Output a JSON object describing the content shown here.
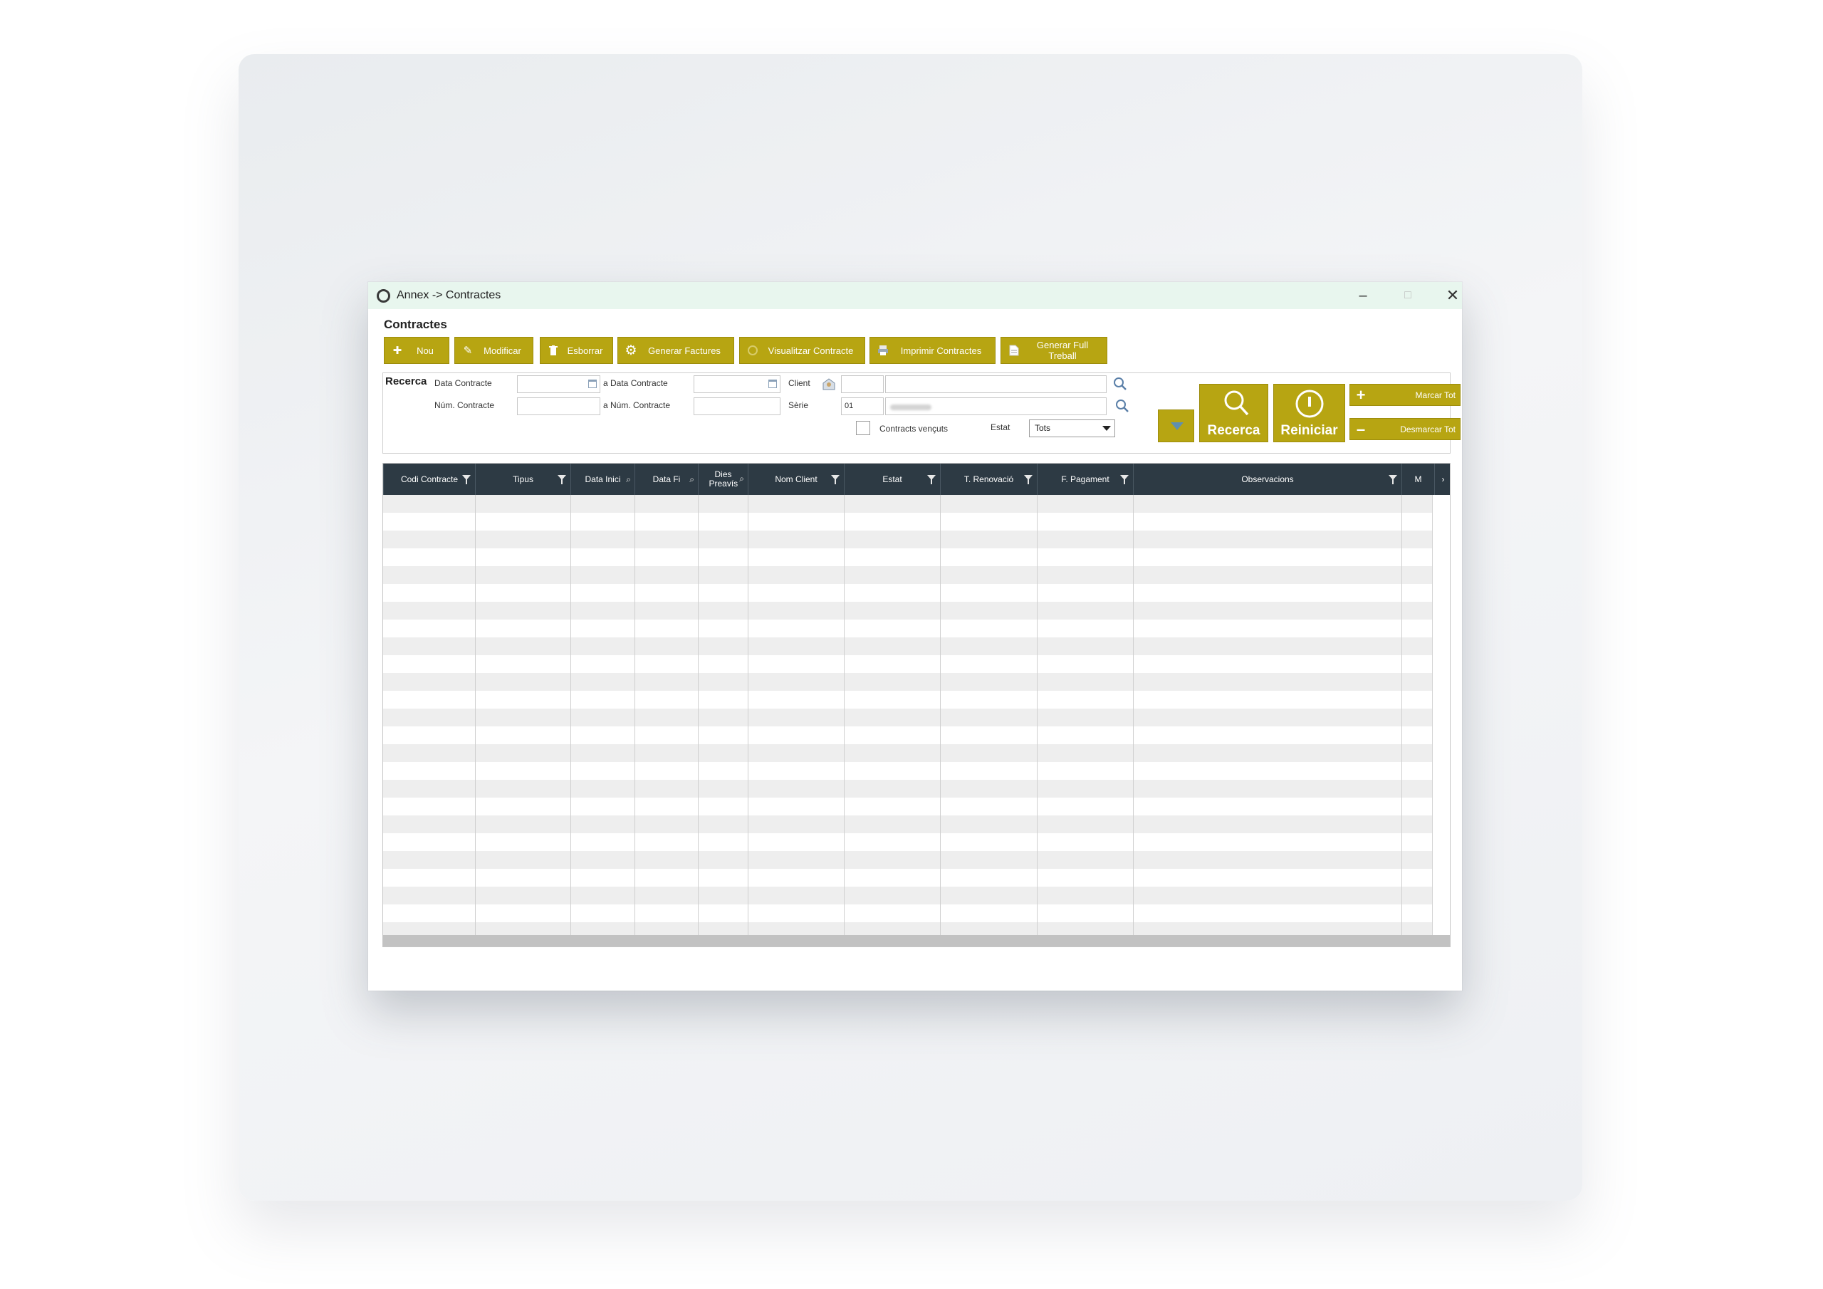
{
  "window": {
    "title": "Annex -> Contractes",
    "controls": {
      "minimize": "–",
      "maximize": "□",
      "close": "✕"
    }
  },
  "section_title": "Contractes",
  "toolbar": [
    {
      "label": "Nou",
      "icon": "plus-icon"
    },
    {
      "label": "Modificar",
      "icon": "pencil-icon"
    },
    {
      "label": "Esborrar",
      "icon": "trash-icon"
    },
    {
      "label": "Generar Factures",
      "icon": "gear-icon"
    },
    {
      "label": "Visualitzar Contracte",
      "icon": "view-icon"
    },
    {
      "label": "Imprimir Contractes",
      "icon": "printer-icon"
    },
    {
      "label": "Generar Full Treball",
      "icon": "document-icon"
    }
  ],
  "search": {
    "heading": "Recerca",
    "data_contracte_label": "Data Contracte",
    "a_data_contracte_label": "a Data Contracte",
    "num_contracte_label": "Núm. Contracte",
    "a_num_contracte_label": "a Núm. Contracte",
    "client_label": "Client",
    "serie_label": "Sèrie",
    "serie_code": "01",
    "contracts_vencuts_label": "Contracts vençuts",
    "estat_label": "Estat",
    "estat_value": "Tots",
    "recerca_button": "Recerca",
    "reiniciar_button": "Reiniciar",
    "marcar_tot": "Marcar Tot",
    "desmarcar_tot": "Desmarcar Tot"
  },
  "grid": {
    "columns": [
      {
        "label": "Codi Contracte",
        "icon": "funnel"
      },
      {
        "label": "Tipus",
        "icon": "funnel"
      },
      {
        "label": "Data Inici",
        "icon": "search"
      },
      {
        "label": "Data Fi",
        "icon": "search"
      },
      {
        "label": "Dies Preavís",
        "icon": "search"
      },
      {
        "label": "Nom Client",
        "icon": "funnel"
      },
      {
        "label": "Estat",
        "icon": "funnel"
      },
      {
        "label": "T. Renovació",
        "icon": "funnel"
      },
      {
        "label": "F. Pagament",
        "icon": "funnel"
      },
      {
        "label": "Observacions",
        "icon": "funnel"
      },
      {
        "label": "M",
        "icon": ""
      }
    ],
    "scroll_right": "›"
  },
  "colors": {
    "accent": "#b7a512",
    "header_bg": "#2d3a44",
    "titlebar_bg": "#e8f6ee"
  }
}
